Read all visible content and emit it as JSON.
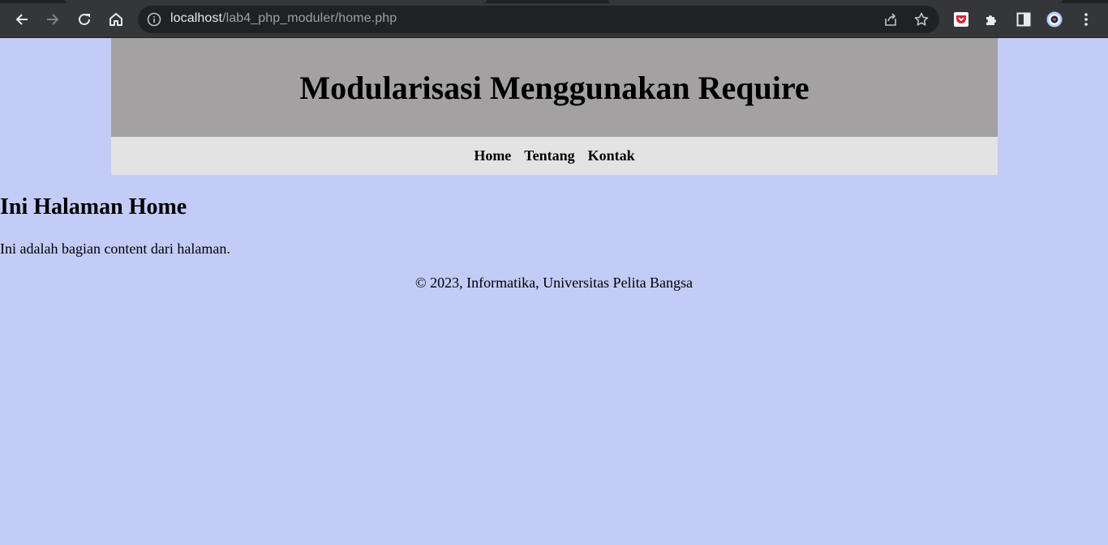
{
  "browser": {
    "url_host": "localhost",
    "url_path": "/lab4_php_moduler/home.php",
    "icons": [
      "back-arrow-icon",
      "forward-arrow-icon",
      "reload-icon",
      "home-icon",
      "info-icon",
      "share-icon",
      "star-icon",
      "pocket-icon",
      "extensions-icon",
      "side-panel-icon",
      "profile-avatar",
      "kebab-menu-icon"
    ]
  },
  "page": {
    "header_title": "Modularisasi Menggunakan Require",
    "nav": [
      {
        "label": "Home"
      },
      {
        "label": "Tentang"
      },
      {
        "label": "Kontak"
      }
    ],
    "content": {
      "heading": "Ini Halaman Home",
      "paragraph": "Ini adalah bagian content dari halaman."
    },
    "footer": "© 2023, Informatika, Universitas Pelita Bangsa"
  },
  "colors": {
    "page_bg": "#c3cbf7",
    "header_bg": "#a3a1a2",
    "nav_bg": "#e3e3e3",
    "chrome_bg": "#35363a",
    "omnibox_bg": "#202124"
  }
}
